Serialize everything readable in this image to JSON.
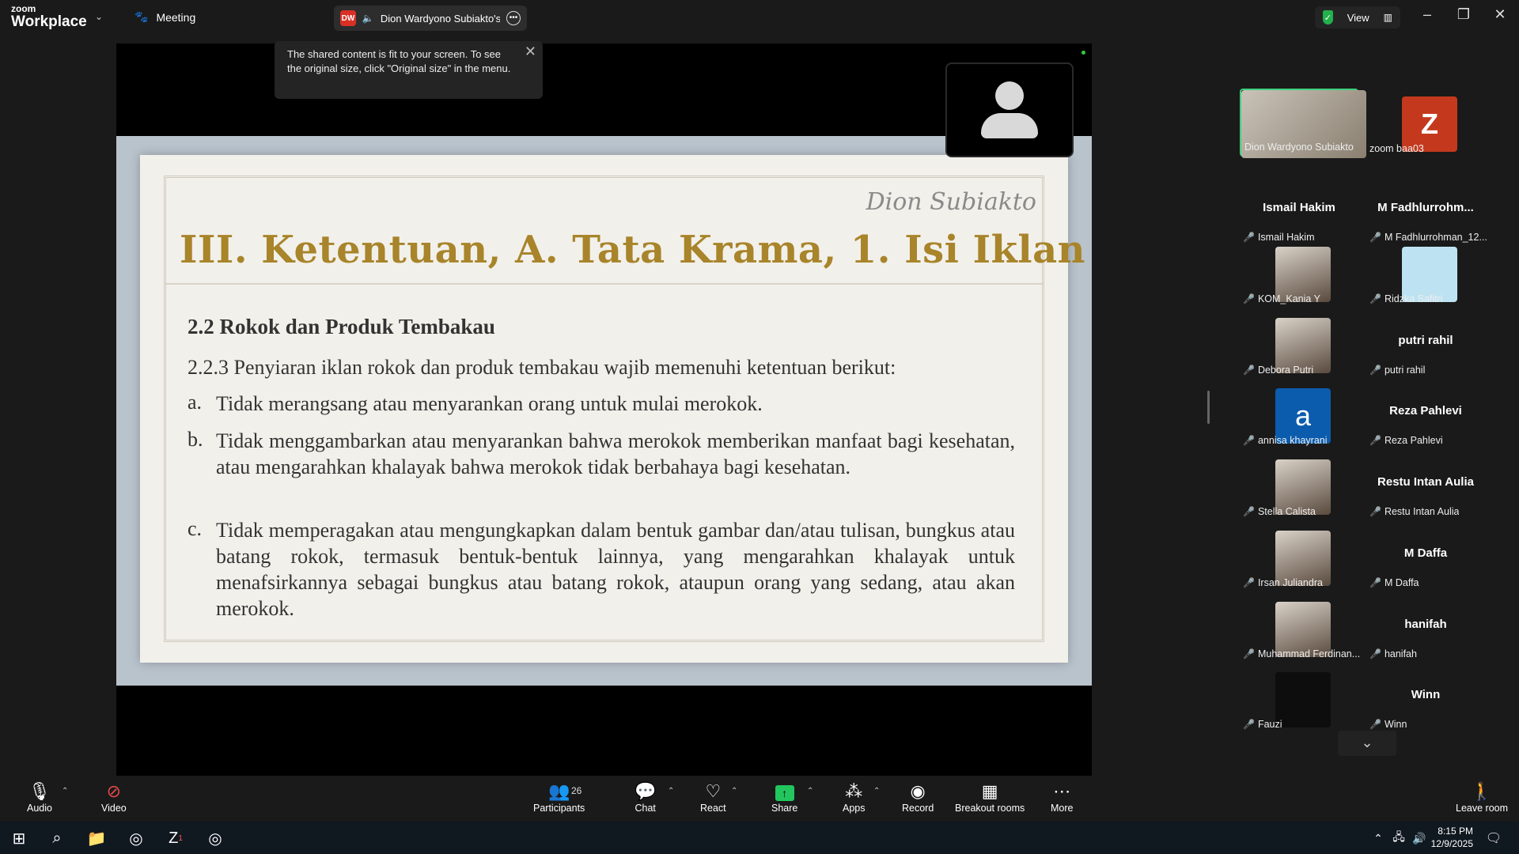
{
  "titlebar": {
    "logo_small": "zoom",
    "logo_big": "Workplace",
    "meeting_tab": "Meeting",
    "share_badge": "DW",
    "share_title": "Dion Wardyono Subiakto's sc",
    "view_label": "View"
  },
  "toast": {
    "text": "The shared content is fit to your screen. To see the original size, click \"Original size\" in the menu."
  },
  "slide": {
    "signature": "Dion Subiakto",
    "title": "III. Ketentuan, A. Tata Krama, 1. Isi Iklan",
    "section": "2.2 Rokok dan Produk Tembakau",
    "intro": "2.2.3 Penyiaran iklan rokok dan produk tembakau wajib memenuhi ketentuan berikut:",
    "items": [
      {
        "letter": "a.",
        "text": "Tidak merangsang atau menyarankan orang untuk mulai merokok."
      },
      {
        "letter": "b.",
        "text": "Tidak menggambarkan atau menyarankan bahwa merokok memberikan manfaat bagi kesehatan, atau mengarahkan khalayak bahwa merokok tidak berbahaya bagi kesehatan."
      },
      {
        "letter": "c.",
        "text": "Tidak memperagakan atau mengungkapkan dalam bentuk gambar dan/atau tulisan, bungkus atau batang rokok, termasuk bentuk-bentuk lainnya, yang mengarahkan khalayak untuk menafsirkannya sebagai bungkus atau batang rokok, ataupun orang yang sedang, atau akan merokok."
      }
    ]
  },
  "gallery": {
    "participants": [
      {
        "label": "Dion Wardyono Subiakto",
        "name": "",
        "pic": "video"
      },
      {
        "label": "zoom baa03",
        "name": "",
        "pic": "letter-z"
      },
      {
        "label": "Ismail Hakim",
        "name": "Ismail Hakim",
        "pic": ""
      },
      {
        "label": "M Fadhlurrohman_12...",
        "name": "M  Fadhlurrohm...",
        "pic": ""
      },
      {
        "label": "KOM_Kania Y",
        "name": "",
        "pic": "photo"
      },
      {
        "label": "Ridzka Safitri",
        "name": "",
        "pic": "plain"
      },
      {
        "label": "Debora Putri",
        "name": "",
        "pic": "photo"
      },
      {
        "label": "putri rahil",
        "name": "putri rahil",
        "pic": ""
      },
      {
        "label": "annisa khayrani",
        "name": "",
        "pic": "letter-a"
      },
      {
        "label": "Reza Pahlevi",
        "name": "Reza Pahlevi",
        "pic": ""
      },
      {
        "label": "Stella Calista",
        "name": "",
        "pic": "photo"
      },
      {
        "label": "Restu Intan Aulia",
        "name": "Restu Intan Aulia",
        "pic": ""
      },
      {
        "label": "Irsan Juliandra",
        "name": "",
        "pic": "photo"
      },
      {
        "label": "M Daffa",
        "name": "M Daffa",
        "pic": ""
      },
      {
        "label": "Muhammad Ferdinan...",
        "name": "",
        "pic": "photo"
      },
      {
        "label": "hanifah",
        "name": "hanifah",
        "pic": ""
      },
      {
        "label": "Fauzi",
        "name": "",
        "pic": "dark"
      },
      {
        "label": "Winn",
        "name": "Winn",
        "pic": ""
      }
    ],
    "letter_z": "Z",
    "letter_a": "a"
  },
  "toolbar": {
    "audio": "Audio",
    "video": "Video",
    "participants": "Participants",
    "participants_count": "26",
    "chat": "Chat",
    "react": "React",
    "share": "Share",
    "apps": "Apps",
    "record": "Record",
    "breakout": "Breakout rooms",
    "more": "More",
    "leave": "Leave room"
  },
  "taskbar": {
    "time": "8:15 PM",
    "date": "12/9/2025",
    "zoom_badge": "1"
  },
  "colors": {
    "accent_green": "#22c55e",
    "mute_red": "#e34848",
    "title_gold": "#a8842a"
  }
}
